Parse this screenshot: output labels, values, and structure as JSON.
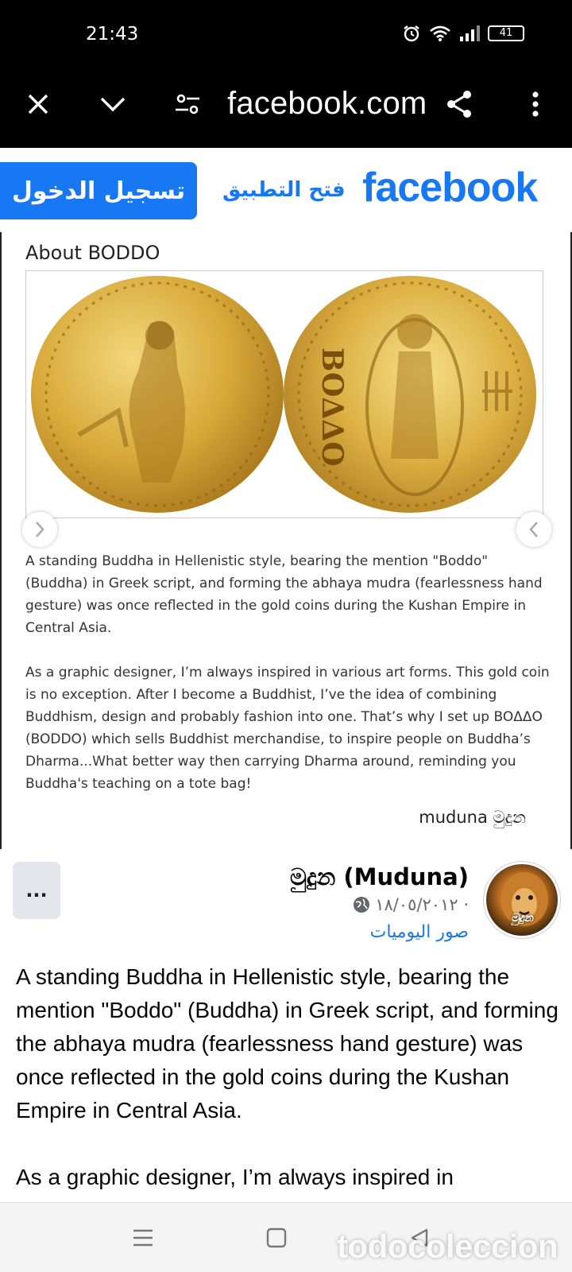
{
  "status_bar": {
    "time": "21:43",
    "battery": "41"
  },
  "browser": {
    "url": "facebook.com"
  },
  "header": {
    "logo": "facebook",
    "open_app": "فتح التطبيق",
    "login": "تسجيل الدخول"
  },
  "image": {
    "title": "About BODDO",
    "coin_inscription": "BOΔΔO",
    "caption_p1": "A standing Buddha in Hellenistic style, bearing the mention \"Boddo\" (Buddha) in Greek script, and forming the abhaya mudra (fearlessness hand gesture) was once reflected in the gold coins during the Kushan Empire in Central Asia.",
    "caption_p2": "As a graphic designer, I’m always inspired in various art forms. This gold coin is no exception. After I become a Buddhist, I’ve the idea of combining Buddhism, design and probably fashion into one. That’s why I set up BOΔΔO (BODDO) which sells Buddhist merchandise, to inspire people on Buddha’s Dharma...What better way then carrying Dharma around, reminding you Buddha's teaching on a tote bag!",
    "signature": "muduna මුදුන"
  },
  "post": {
    "page_name": "මුදුන (Muduna)",
    "date": "١٨/٠٥/٢٠١٢ ·",
    "album": "صور اليوميات",
    "avatar_text": "මුදුන",
    "text_p1": "A standing Buddha in Hellenistic style, bearing the mention \"Boddo\" (Buddha) in Greek script, and forming the abhaya mudra (fearlessness hand gesture) was once reflected in the gold coins during the Kushan Empire in Central Asia.",
    "text_p2_visible": "As a graphic designer, I’m always inspired in",
    "more": "..."
  },
  "watermark": "todocoleccion",
  "colors": {
    "facebook_blue": "#1877f2",
    "gold": "#d8a93a"
  },
  "icons": [
    "close-icon",
    "chevron-down-icon",
    "page-settings-icon",
    "share-icon",
    "more-vert-icon",
    "alarm-icon",
    "wifi-icon",
    "signal-icon",
    "battery-icon",
    "globe-icon",
    "menu-icon",
    "home-square-icon",
    "back-triangle-icon"
  ]
}
